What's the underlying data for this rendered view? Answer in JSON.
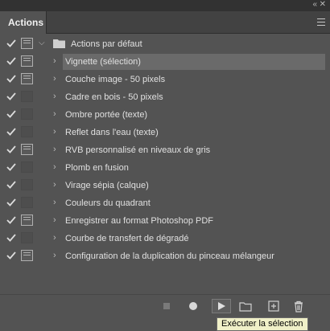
{
  "panel": {
    "tab_label": "Actions",
    "colors": {
      "background": "#535353",
      "selected_row": "#6a6a6a",
      "tooltip_bg": "#f0f0c8"
    }
  },
  "actions": [
    {
      "label": "Actions par défaut",
      "checked": true,
      "dialog": true,
      "kind": "set",
      "expanded": true
    },
    {
      "label": "Vignette (sélection)",
      "checked": true,
      "dialog": true,
      "kind": "action",
      "selected": true
    },
    {
      "label": "Couche image - 50 pixels",
      "checked": true,
      "dialog": true,
      "kind": "action"
    },
    {
      "label": "Cadre en bois - 50 pixels",
      "checked": true,
      "dialog": false,
      "kind": "action"
    },
    {
      "label": "Ombre portée (texte)",
      "checked": true,
      "dialog": false,
      "kind": "action"
    },
    {
      "label": "Reflet dans l'eau (texte)",
      "checked": true,
      "dialog": false,
      "kind": "action"
    },
    {
      "label": "RVB personnalisé en niveaux de gris",
      "checked": true,
      "dialog": true,
      "kind": "action"
    },
    {
      "label": "Plomb en fusion",
      "checked": true,
      "dialog": false,
      "kind": "action"
    },
    {
      "label": "Virage sépia (calque)",
      "checked": true,
      "dialog": false,
      "kind": "action"
    },
    {
      "label": "Couleurs du quadrant",
      "checked": true,
      "dialog": false,
      "kind": "action"
    },
    {
      "label": "Enregistrer au format Photoshop PDF",
      "checked": true,
      "dialog": true,
      "kind": "action"
    },
    {
      "label": "Courbe de transfert de dégradé",
      "checked": true,
      "dialog": false,
      "kind": "action"
    },
    {
      "label": "Configuration de la duplication du pinceau mélangeur",
      "checked": true,
      "dialog": true,
      "kind": "action"
    }
  ],
  "toolbar": {
    "buttons": [
      "stop-icon",
      "record-icon",
      "play-icon",
      "new-set-icon",
      "new-action-icon",
      "trash-icon"
    ]
  },
  "tooltip": {
    "text": "Exécuter la sélection"
  }
}
